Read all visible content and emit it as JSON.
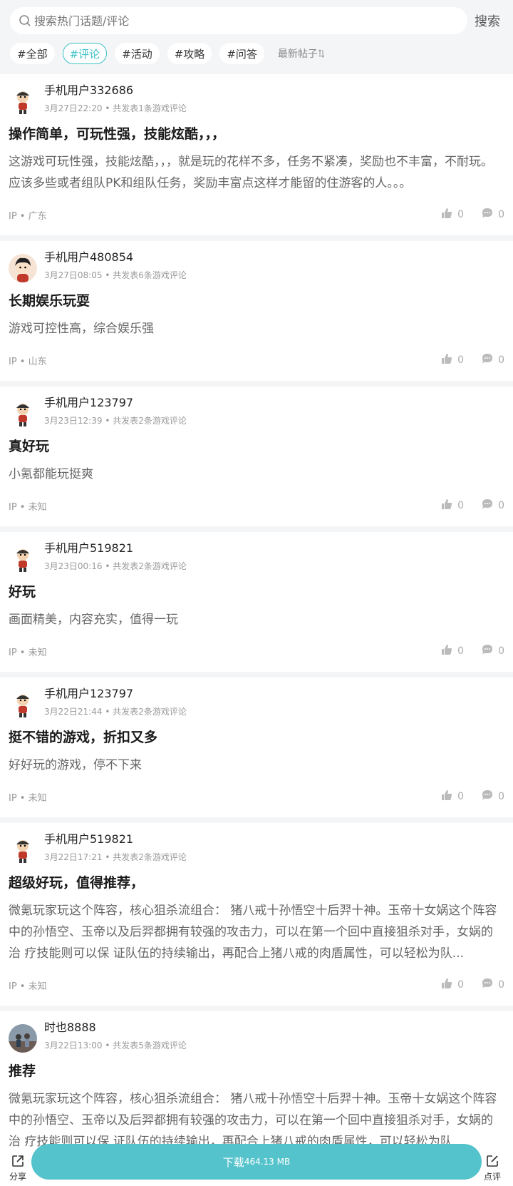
{
  "search": {
    "placeholder": "搜索热门话题/评论",
    "button_label": "搜索"
  },
  "filters": [
    "#全部",
    "#评论",
    "#活动",
    "#攻略",
    "#问答"
  ],
  "active_filter": "#评论",
  "sort_label": "最新帖子",
  "colors": {
    "accent": "#3ec1c6",
    "download": "#55c3cb"
  },
  "posts": [
    {
      "username": "手机用户332686",
      "time": "3月27日22:20",
      "count_text": "共发表1条游戏评论",
      "title": "操作简单，可玩性强，技能炫酷，，，",
      "body": "这游戏可玩性强，技能炫酷，，，就是玩的花样不多，任务不紧凑，奖励也不丰富，不耐玩。应该多些或者组队PK和组队任务，奖励丰富点这样才能留的住游客的人。。。",
      "ip": "IP • 广东",
      "likes": "0",
      "comments": "0",
      "avatar_icon": "cartoon-character-icon"
    },
    {
      "username": "手机用户480854",
      "time": "3月27日08:05",
      "count_text": "共发表6条游戏评论",
      "title": "长期娱乐玩耍",
      "body": "游戏可控性高，综合娱乐强",
      "ip": "IP • 山东",
      "likes": "0",
      "comments": "0",
      "avatar_icon": "cartoon-boy-icon"
    },
    {
      "username": "手机用户123797",
      "time": "3月23日12:39",
      "count_text": "共发表2条游戏评论",
      "title": "真好玩",
      "body": "小氪都能玩挺爽",
      "ip": "IP • 未知",
      "likes": "0",
      "comments": "0",
      "avatar_icon": "cartoon-character-icon"
    },
    {
      "username": "手机用户519821",
      "time": "3月23日00:16",
      "count_text": "共发表2条游戏评论",
      "title": "好玩",
      "body": "画面精美，内容充实，值得一玩",
      "ip": "IP • 未知",
      "likes": "0",
      "comments": "0",
      "avatar_icon": "cartoon-character-icon"
    },
    {
      "username": "手机用户123797",
      "time": "3月22日21:44",
      "count_text": "共发表2条游戏评论",
      "title": "挺不错的游戏，折扣又多",
      "body": "好好玩的游戏，停不下来",
      "ip": "IP • 未知",
      "likes": "0",
      "comments": "0",
      "avatar_icon": "cartoon-character-icon"
    },
    {
      "username": "手机用户519821",
      "time": "3月22日17:21",
      "count_text": "共发表2条游戏评论",
      "title": "超级好玩，值得推荐，",
      "body": "微氪玩家玩这个阵容，核心狙杀流组合： 猪八戒十孙悟空十后羿十神。玉帝十女娲这个阵容中的孙悟空、玉帝以及后羿都拥有较强的攻击力，可以在第一个回中直接狙杀对手，女娲的治 疗技能则可以保 证队伍的持续输出，再配合上猪八戒的肉盾属性，可以轻松为队...",
      "ip": "IP • 未知",
      "likes": "0",
      "comments": "0",
      "avatar_icon": "cartoon-character-icon"
    },
    {
      "username": "时也8888",
      "time": "3月22日13:00",
      "count_text": "共发表5条游戏评论",
      "title": "推荐",
      "body": "微氪玩家玩这个阵容，核心狙杀流组合： 猪八戒十孙悟空十后羿十神。玉帝十女娲这个阵容中的孙悟空、玉帝以及后羿都拥有较强的攻击力，可以在第一个回中直接狙杀对手，女娲的治 疗技能则可以保 证队伍的持续输出，再配合上猪八戒的肉盾属性，可以轻松为队",
      "ip": "",
      "likes": "",
      "comments": "",
      "avatar_icon": "photo-avatar-icon"
    }
  ],
  "bottom": {
    "share_label": "分享",
    "download_label": "下载",
    "download_size": "464.13 MB",
    "review_label": "点评"
  }
}
